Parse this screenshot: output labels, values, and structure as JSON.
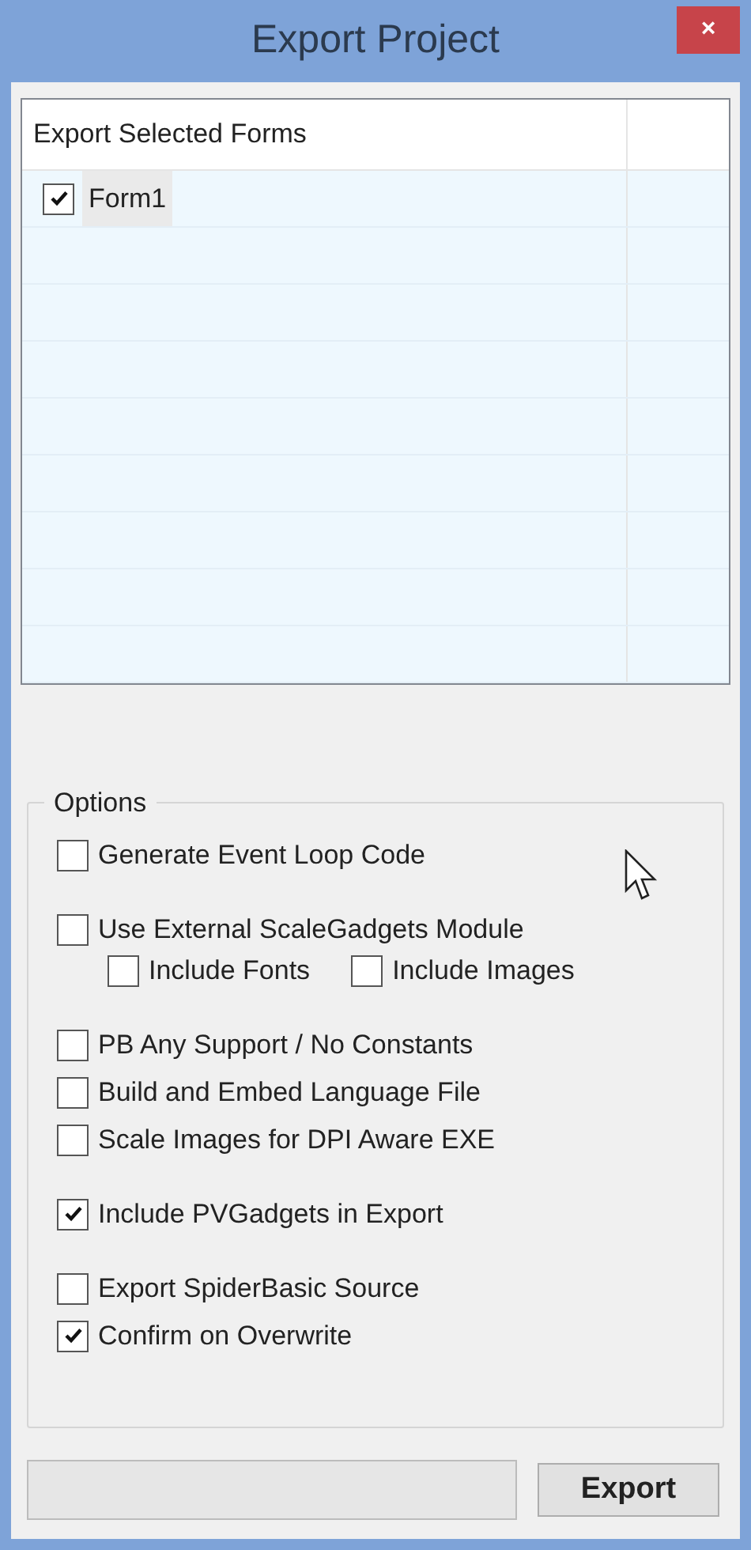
{
  "window": {
    "title": "Export Project",
    "close": "×"
  },
  "forms_list": {
    "column": "Export Selected Forms",
    "rows": [
      {
        "label": "Form1",
        "checked": true
      }
    ]
  },
  "options": {
    "title": "Options",
    "groups": [
      [
        {
          "label": "Generate Event Loop Code",
          "checked": false
        }
      ],
      [
        {
          "label": "Use External ScaleGadgets Module",
          "checked": false,
          "children": [
            {
              "label": "Include Fonts",
              "checked": false
            },
            {
              "label": "Include Images",
              "checked": false
            }
          ]
        }
      ],
      [
        {
          "label": "PB Any Support / No Constants",
          "checked": false
        },
        {
          "label": "Build and Embed Language File",
          "checked": false
        },
        {
          "label": "Scale Images for DPI Aware EXE",
          "checked": false
        }
      ],
      [
        {
          "label": "Include PVGadgets in Export",
          "checked": true
        }
      ],
      [
        {
          "label": "Export SpiderBasic Source",
          "checked": false
        },
        {
          "label": "Confirm on Overwrite",
          "checked": true
        }
      ]
    ]
  },
  "progress": {
    "level": 0
  },
  "buttons": [
    "Export"
  ]
}
